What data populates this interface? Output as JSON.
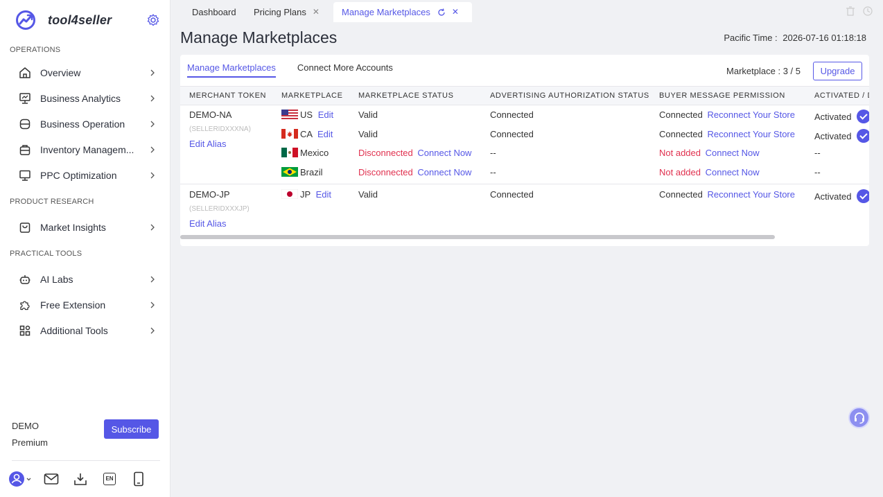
{
  "brand": {
    "name": "tool4seller"
  },
  "sidebar": {
    "sections": [
      {
        "title": "OPERATIONS"
      },
      {
        "title": "PRODUCT RESEARCH"
      },
      {
        "title": "PRACTICAL TOOLS"
      }
    ],
    "items": [
      {
        "label": "Overview",
        "icon": "home-icon"
      },
      {
        "label": "Business Analytics",
        "icon": "analytics-icon"
      },
      {
        "label": "Business Operation",
        "icon": "operation-icon"
      },
      {
        "label": "Inventory Managem...",
        "icon": "inventory-icon"
      },
      {
        "label": "PPC Optimization",
        "icon": "monitor-icon"
      },
      {
        "label": "Market Insights",
        "icon": "bag-icon"
      },
      {
        "label": "AI Labs",
        "icon": "robot-icon"
      },
      {
        "label": "Free Extension",
        "icon": "puzzle-icon"
      },
      {
        "label": "Additional Tools",
        "icon": "grid-icon"
      }
    ],
    "account": {
      "name": "DEMO",
      "plan": "Premium",
      "subscribe_label": "Subscribe"
    },
    "lang": "EN"
  },
  "tabs": [
    {
      "label": "Dashboard"
    },
    {
      "label": "Pricing Plans"
    },
    {
      "label": "Manage Marketplaces"
    }
  ],
  "page": {
    "title": "Manage Marketplaces",
    "time_label": "Pacific Time :",
    "time_value": "2026-07-16 01:18:18"
  },
  "subtabs": [
    {
      "label": "Manage Marketplaces"
    },
    {
      "label": "Connect More Accounts"
    }
  ],
  "marketplace_count": "Marketplace : 3 / 5",
  "upgrade_label": "Upgrade",
  "table": {
    "columns": [
      "MERCHANT TOKEN",
      "MARKETPLACE",
      "MARKETPLACE STATUS",
      "ADVERTISING AUTHORIZATION STATUS",
      "BUYER MESSAGE PERMISSION",
      "ACTIVATED / D"
    ],
    "groups": [
      {
        "token": "DEMO-NA",
        "seller_id": "(SELLERIDXXXNA)",
        "alias_label": "Edit Alias",
        "rows": [
          {
            "marketplace": "US",
            "edit": "Edit",
            "status": "Valid",
            "status_action": "",
            "ads": "Connected",
            "buyer": "Connected",
            "buyer_action": "Reconnect Your Store",
            "activated": "Activated"
          },
          {
            "marketplace": "CA",
            "edit": "Edit",
            "status": "Valid",
            "status_action": "",
            "ads": "Connected",
            "buyer": "Connected",
            "buyer_action": "Reconnect Your Store",
            "activated": "Activated"
          },
          {
            "marketplace": "Mexico",
            "edit": "",
            "status": "Disconnected",
            "status_action": "Connect Now",
            "ads": "--",
            "buyer": "Not added",
            "buyer_action": "Connect Now",
            "activated": "--"
          },
          {
            "marketplace": "Brazil",
            "edit": "",
            "status": "Disconnected",
            "status_action": "Connect Now",
            "ads": "--",
            "buyer": "Not added",
            "buyer_action": "Connect Now",
            "activated": "--"
          }
        ]
      },
      {
        "token": "DEMO-JP",
        "seller_id": "(SELLERIDXXXJP)",
        "alias_label": "Edit Alias",
        "rows": [
          {
            "marketplace": "JP",
            "edit": "Edit",
            "status": "Valid",
            "status_action": "",
            "ads": "Connected",
            "buyer": "Connected",
            "buyer_action": "Reconnect Your Store",
            "activated": "Activated"
          }
        ]
      }
    ]
  },
  "colors": {
    "accent": "#5557e6",
    "danger": "#e0304e"
  }
}
